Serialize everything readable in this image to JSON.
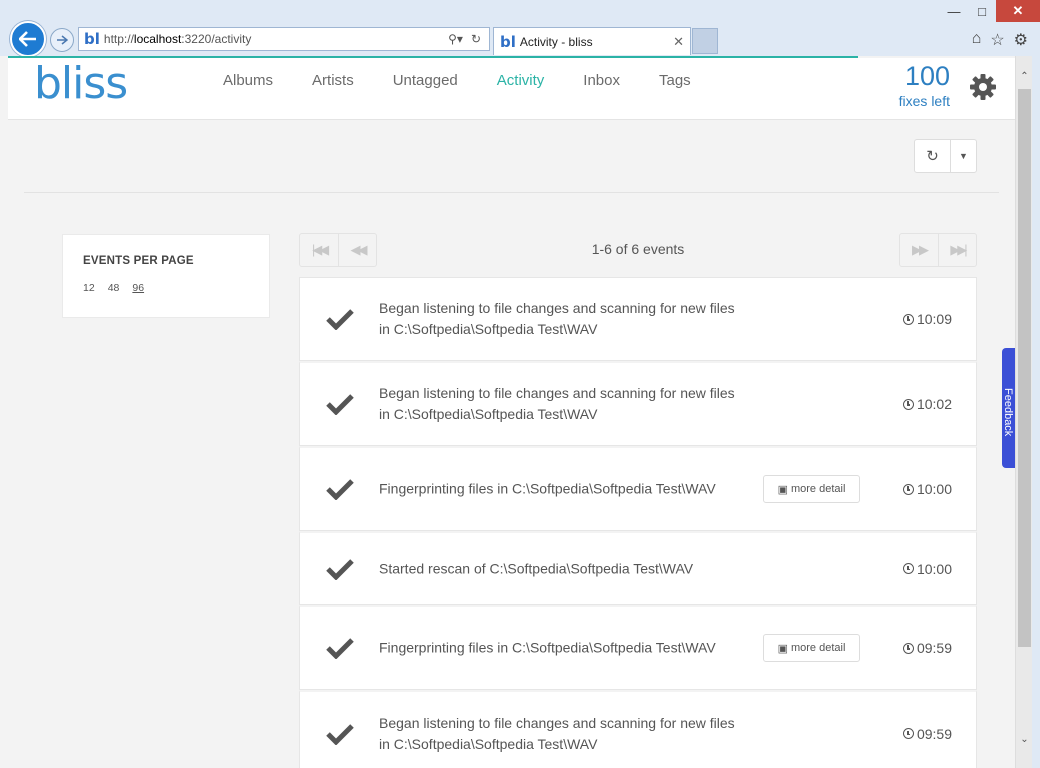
{
  "browser": {
    "url_prefix": "http://",
    "url_host": "localhost",
    "url_rest": ":3220/activity",
    "tab_title": "Activity - bliss",
    "favicon": "bl"
  },
  "app": {
    "logo": "bliss",
    "nav": [
      "Albums",
      "Artists",
      "Untagged",
      "Activity",
      "Inbox",
      "Tags"
    ],
    "active_nav": "Activity",
    "fixes_count": "100",
    "fixes_label": "fixes left"
  },
  "sidebar": {
    "heading": "EVENTS PER PAGE",
    "options": [
      "12",
      "48",
      "96"
    ],
    "selected": "96"
  },
  "pager": {
    "count_text": "1-6 of 6 events"
  },
  "events": [
    {
      "message": "Began listening to file changes and scanning for new files in C:\\Softpedia\\Softpedia Test\\WAV",
      "time": "10:09",
      "detail": ""
    },
    {
      "message": "Began listening to file changes and scanning for new files in C:\\Softpedia\\Softpedia Test\\WAV",
      "time": "10:02",
      "detail": ""
    },
    {
      "message": "Fingerprinting files in C:\\Softpedia\\Softpedia Test\\WAV",
      "time": "10:00",
      "detail": "more detail"
    },
    {
      "message": "Started rescan of C:\\Softpedia\\Softpedia Test\\WAV",
      "time": "10:00",
      "detail": ""
    },
    {
      "message": "Fingerprinting files in C:\\Softpedia\\Softpedia Test\\WAV",
      "time": "09:59",
      "detail": "more detail"
    },
    {
      "message": "Began listening to file changes and scanning for new files in C:\\Softpedia\\Softpedia Test\\WAV",
      "time": "09:59",
      "detail": ""
    }
  ],
  "feedback_label": "Feedback",
  "colors": {
    "brand": "#3a8fcf",
    "accent": "#2bb3a6",
    "feedback": "#3b4fd6"
  }
}
